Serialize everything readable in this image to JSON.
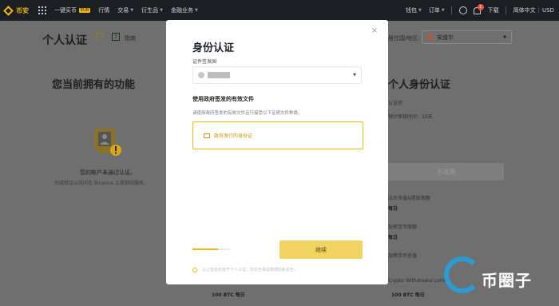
{
  "topbar": {
    "brand": "币安",
    "nav": [
      {
        "label": "一键买币",
        "badge": "EUR"
      },
      {
        "label": "行情"
      },
      {
        "label": "交易",
        "caret": true
      },
      {
        "label": "衍生品",
        "caret": true
      },
      {
        "label": "金融业务",
        "caret": true
      }
    ],
    "right": {
      "wallet": "钱包",
      "orders": "订单",
      "notification_count": "1",
      "download": "下载",
      "language": "简体中文",
      "currency": "USD"
    }
  },
  "background": {
    "page_title": "个人认证",
    "guide": "指南",
    "help": "?",
    "region_label": "居住国/地区：",
    "region_value": "安道尔",
    "features_title": "您当前拥有的功能",
    "unverified": "您的帐户未通过认证。",
    "unverified_hint": "完成验证以访问在 Binance 上提供的服务。",
    "right_title": "个人身份认证",
    "req_1": "认证须",
    "req_2": "预计审核时间：10天",
    "na_button": "不适用",
    "limit_1": "法币充值&提现限额",
    "limit_1_val": "每日",
    "limit_2": "加密货币限额",
    "limit_2_val": "每日",
    "limit_3": "加密货币充值",
    "limit_4": "Crypto Withdrawal Limit",
    "btc_left": "100 BTC 每日",
    "btc_right": "100 BTC 每日"
  },
  "modal": {
    "title": "身份认证",
    "issue_country_label": "证件签发国",
    "doc_heading": "使用政府签发的有效文件",
    "doc_hint": "请使用政府签发的有效文件且只接受以下证明文件种类。",
    "doc_option": "政府发行的身份证",
    "close": "×",
    "continue": "继续",
    "privacy": "以上信息仅用于个人认证，并安全保证数据隐私安全。",
    "progress": 0.7
  },
  "watermark": {
    "text": "币圈子"
  },
  "colors": {
    "accent": "#f0b90b",
    "topbar": "#1b1e22",
    "button": "#f0d361"
  }
}
